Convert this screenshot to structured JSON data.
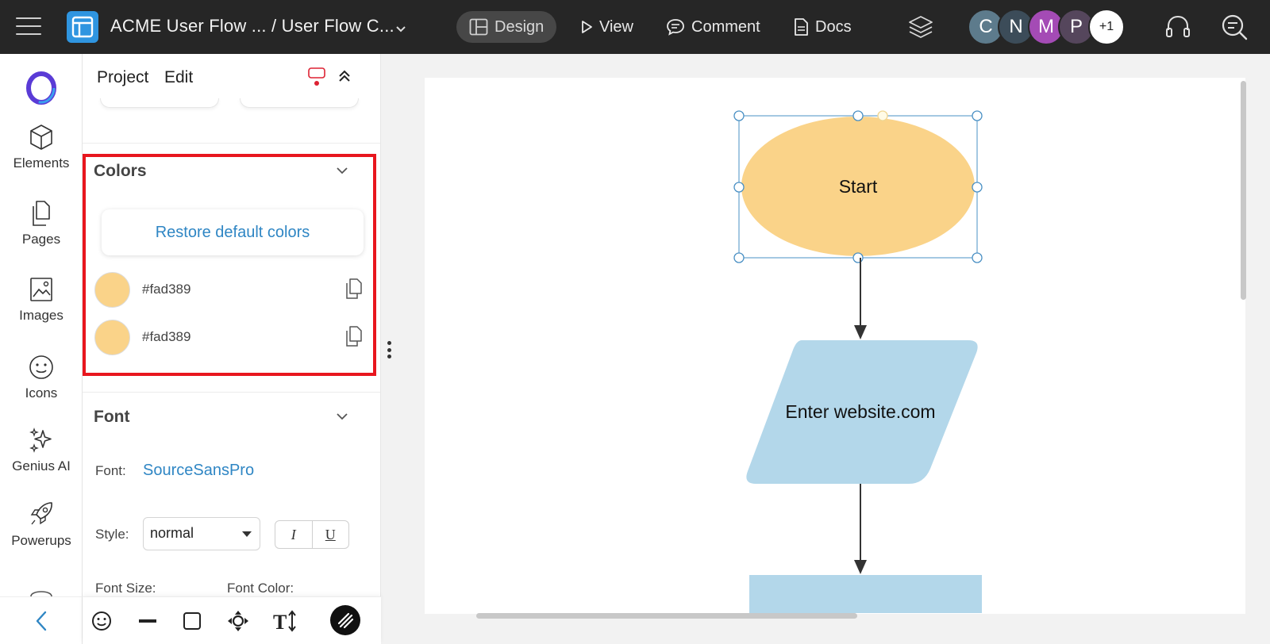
{
  "topbar": {
    "doc_title": "ACME User Flow ... / User Flow C...",
    "modes": [
      "Design",
      "View",
      "Comment",
      "Docs"
    ],
    "avatars": [
      {
        "initial": "C",
        "color": "#5d7b8c"
      },
      {
        "initial": "N",
        "color": "#3c4c59"
      },
      {
        "initial": "M",
        "color": "#a44bb5"
      },
      {
        "initial": "P",
        "color": "#55465c"
      }
    ],
    "more_users": "+1"
  },
  "rail": {
    "items": [
      "Elements",
      "Pages",
      "Images",
      "Icons",
      "Genius AI",
      "Powerups"
    ]
  },
  "panel": {
    "menu": [
      "Project",
      "Edit"
    ],
    "colors": {
      "title": "Colors",
      "restore_label": "Restore default colors",
      "swatches": [
        {
          "hex": "#fad389",
          "color": "#fad389"
        },
        {
          "hex": "#fad389",
          "color": "#fad389"
        }
      ]
    },
    "font": {
      "title": "Font",
      "font_label": "Font:",
      "font_name": "SourceSansPro",
      "style_label": "Style:",
      "style_value": "normal",
      "italic_label": "I",
      "underline_label": "U",
      "size_label": "Font Size:",
      "color_label": "Font Color:"
    }
  },
  "diagram": {
    "start_label": "Start",
    "start_fill": "#fad389",
    "input_label": "Enter website.com",
    "input_fill": "#b3d7ea",
    "process_fill": "#b3d7ea",
    "selection_color": "#4a90c4"
  }
}
